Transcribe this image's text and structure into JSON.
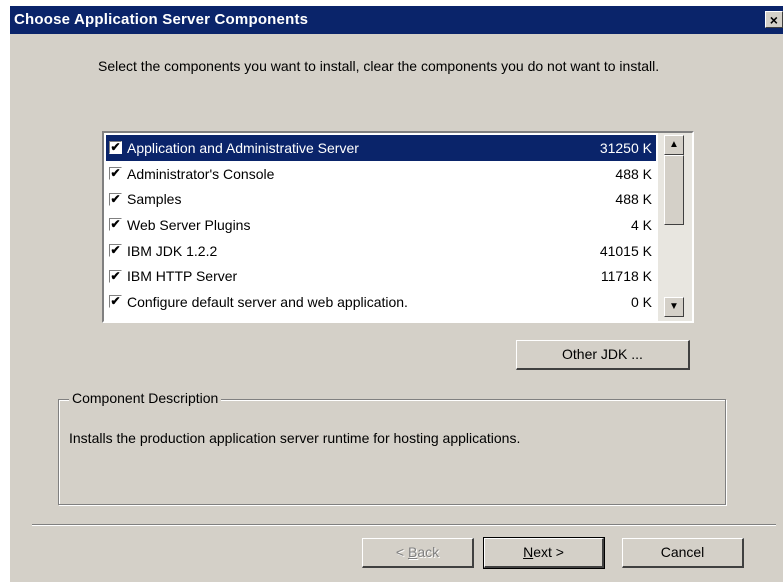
{
  "dialog": {
    "title": "Choose Application Server Components",
    "close_glyph": "×"
  },
  "instructions": "Select the components you want to install, clear the components you do not want to install.",
  "components": [
    {
      "label": "Application and Administrative Server",
      "size": "31250 K",
      "checked": true,
      "selected": true
    },
    {
      "label": "Administrator's Console",
      "size": "488 K",
      "checked": true,
      "selected": false
    },
    {
      "label": "Samples",
      "size": "488 K",
      "checked": true,
      "selected": false
    },
    {
      "label": "Web Server Plugins",
      "size": "4 K",
      "checked": true,
      "selected": false
    },
    {
      "label": "IBM JDK 1.2.2",
      "size": "41015 K",
      "checked": true,
      "selected": false
    },
    {
      "label": "IBM HTTP Server",
      "size": "11718 K",
      "checked": true,
      "selected": false
    },
    {
      "label": "Configure default server and web application.",
      "size": "0 K",
      "checked": true,
      "selected": false
    }
  ],
  "check_glyph": "✔",
  "scroll": {
    "up_glyph": "▲",
    "down_glyph": "▼"
  },
  "other_jdk_label": "Other JDK ...",
  "description": {
    "legend": "Component Description",
    "text": "Installs the production application server runtime for hosting applications."
  },
  "buttons": {
    "back": {
      "prefix": "< ",
      "mnemonic": "B",
      "rest": "ack"
    },
    "next": {
      "mnemonic": "N",
      "rest": "ext >"
    },
    "cancel": "Cancel"
  },
  "colors": {
    "selection": "#0a246a",
    "face": "#d4d0c8"
  }
}
